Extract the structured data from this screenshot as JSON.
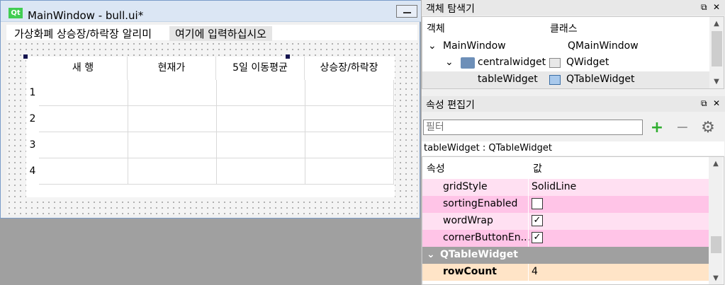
{
  "window": {
    "title": "MainWindow - bull.ui*",
    "logo_text": "Qt"
  },
  "menu": {
    "items": [
      "가상화폐 상승장/하락장 알리미",
      "여기에 입력하십시오"
    ]
  },
  "table": {
    "columns": [
      "새 행",
      "현재가",
      "5일 이동평균",
      "상승장/하락장"
    ],
    "rows": [
      "1",
      "2",
      "3",
      "4"
    ]
  },
  "object_inspector": {
    "title": "객체 탐색기",
    "col_object": "객체",
    "col_class": "클래스",
    "items": [
      {
        "name": "MainWindow",
        "class": "QMainWindow"
      },
      {
        "name": "centralwidget",
        "class": "QWidget"
      },
      {
        "name": "tableWidget",
        "class": "QTableWidget"
      }
    ]
  },
  "property_editor": {
    "title": "속성 편집기",
    "filter_placeholder": "필터",
    "path": "tableWidget : QTableWidget",
    "col_property": "속성",
    "col_value": "값",
    "rows": [
      {
        "name": "gridStyle",
        "value": "SolidLine"
      },
      {
        "name": "sortingEnabled",
        "checked": ""
      },
      {
        "name": "wordWrap",
        "checked": "✓"
      },
      {
        "name": "cornerButtonEn...",
        "checked": "✓"
      }
    ],
    "group": "QTableWidget",
    "row_count": {
      "name": "rowCount",
      "value": "4"
    }
  },
  "colors": {
    "pink_light": "#ffe0f2",
    "pink_dark": "#ffc4e7",
    "group_gray": "#a0a0a0",
    "highlight_orange": "#ffe4c7",
    "selection_handle": "#14144f"
  }
}
